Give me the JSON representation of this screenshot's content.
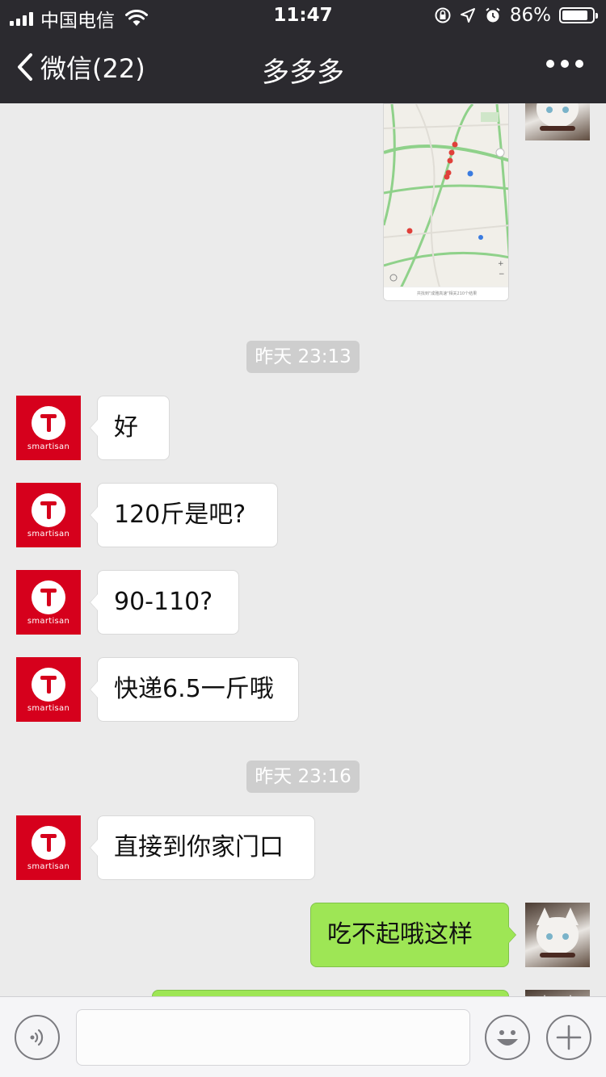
{
  "status_bar": {
    "carrier": "中国电信",
    "time": "11:47",
    "battery_percent": "86%",
    "battery_level": 0.86,
    "icons": [
      "signal-icon",
      "wifi-icon",
      "rotation-lock-icon",
      "location-icon",
      "alarm-icon",
      "battery-icon"
    ]
  },
  "nav": {
    "back_label": "微信(22)",
    "title": "多多多",
    "more_icon": "more-icon"
  },
  "messages": [
    {
      "type": "map",
      "sender": "self",
      "caption": "共找到\"成雅高速\"相关210个结果"
    },
    {
      "type": "time",
      "text": "昨天 23:13"
    },
    {
      "type": "text",
      "sender": "other",
      "text": "好"
    },
    {
      "type": "text",
      "sender": "other",
      "text": "120斤是吧?"
    },
    {
      "type": "text",
      "sender": "other",
      "text": "90-110?"
    },
    {
      "type": "text",
      "sender": "other",
      "text": "快递6.5一斤哦"
    },
    {
      "type": "time",
      "text": "昨天 23:16"
    },
    {
      "type": "text",
      "sender": "other",
      "text": "直接到你家门口"
    },
    {
      "type": "text",
      "sender": "self",
      "text": "吃不起哦这样"
    },
    {
      "type": "text",
      "sender": "self",
      "text": ""
    }
  ],
  "avatars": {
    "other_brand": "smartisan"
  },
  "input_bar": {
    "voice_icon": "voice-icon",
    "emoji_icon": "emoji-icon",
    "plus_icon": "plus-icon",
    "value": ""
  },
  "colors": {
    "nav_bg": "#2b2a2f",
    "chat_bg": "#ebebeb",
    "self_bubble": "#9ee655",
    "other_bubble": "#ffffff",
    "avatar_red": "#d6001c",
    "timestamp_bg": "#cecece"
  }
}
